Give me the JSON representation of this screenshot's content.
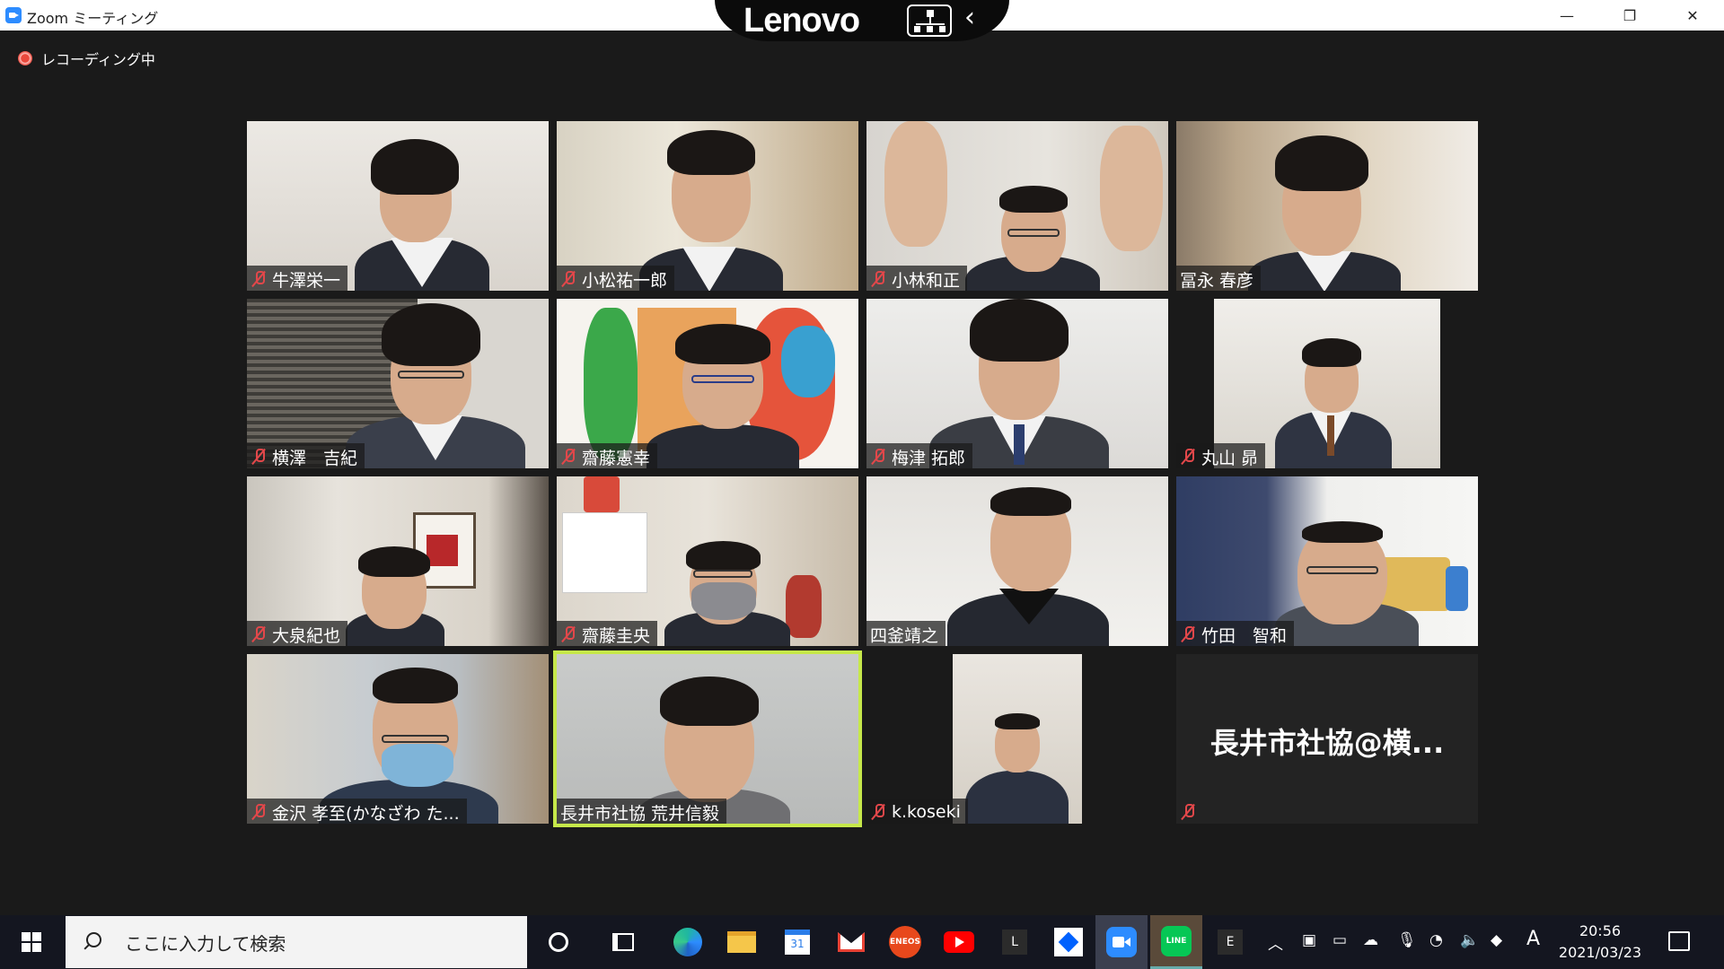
{
  "window": {
    "title": "Zoom ミーティング",
    "minimize": "—",
    "restore": "❐",
    "close": "✕"
  },
  "overlay": {
    "brand": "Lenovo",
    "back": "‹"
  },
  "recording": {
    "label": "レコーディング中"
  },
  "participants": [
    {
      "name": "牛澤栄一",
      "muted": true
    },
    {
      "name": "小松祐一郎",
      "muted": true
    },
    {
      "name": "小林和正",
      "muted": true
    },
    {
      "name": "冨永 春彦",
      "muted": false
    },
    {
      "name": "横澤　吉紀",
      "muted": true
    },
    {
      "name": "齋藤憲幸",
      "muted": true
    },
    {
      "name": "梅津 拓郎",
      "muted": true
    },
    {
      "name": "丸山 昴",
      "muted": true
    },
    {
      "name": "大泉紀也",
      "muted": true
    },
    {
      "name": "齋藤圭央",
      "muted": true
    },
    {
      "name": "四釜靖之",
      "muted": false
    },
    {
      "name": "竹田　智和",
      "muted": true
    },
    {
      "name": "金沢 孝至(かなざわ た...",
      "muted": true
    },
    {
      "name": "長井市社協 荒井信毅",
      "muted": false,
      "active_speaker": true
    },
    {
      "name": "k.koseki",
      "muted": true
    },
    {
      "name": "",
      "muted": true,
      "video_off": true,
      "display_name": "長井市社協@横..."
    }
  ],
  "taskbar": {
    "search_placeholder": "ここに入力して検索",
    "apps": [
      "cortana-icon",
      "task-view-icon",
      "edge-icon",
      "file-explorer-icon",
      "calendar-icon",
      "gmail-icon",
      "eneos-icon",
      "youtube-icon",
      "l-app-icon",
      "dropbox-icon",
      "zoom-icon",
      "line-icon",
      "e-app-icon"
    ],
    "calendar_day": "31",
    "eneos_label": "ENEOS",
    "line_label": "LINE",
    "l_label": "L",
    "e_label": "E",
    "ime": "A",
    "time": "20:56",
    "date": "2021/03/23"
  },
  "colors": {
    "zoom_blue": "#2d8cff",
    "muted_red": "#e2474a",
    "active_speaker_border": "#c6e84a",
    "background": "#1a1a1a",
    "taskbar": "#141620"
  }
}
